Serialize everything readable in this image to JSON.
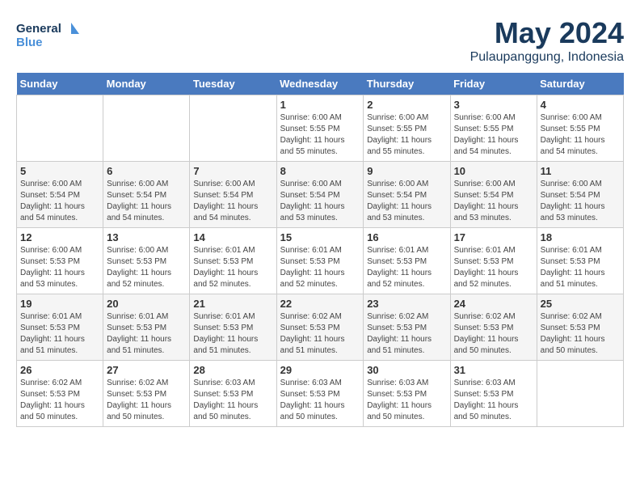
{
  "logo": {
    "line1": "General",
    "line2": "Blue"
  },
  "title": "May 2024",
  "location": "Pulaupanggung, Indonesia",
  "days_header": [
    "Sunday",
    "Monday",
    "Tuesday",
    "Wednesday",
    "Thursday",
    "Friday",
    "Saturday"
  ],
  "weeks": [
    [
      {
        "day": "",
        "info": ""
      },
      {
        "day": "",
        "info": ""
      },
      {
        "day": "",
        "info": ""
      },
      {
        "day": "1",
        "info": "Sunrise: 6:00 AM\nSunset: 5:55 PM\nDaylight: 11 hours\nand 55 minutes."
      },
      {
        "day": "2",
        "info": "Sunrise: 6:00 AM\nSunset: 5:55 PM\nDaylight: 11 hours\nand 55 minutes."
      },
      {
        "day": "3",
        "info": "Sunrise: 6:00 AM\nSunset: 5:55 PM\nDaylight: 11 hours\nand 54 minutes."
      },
      {
        "day": "4",
        "info": "Sunrise: 6:00 AM\nSunset: 5:55 PM\nDaylight: 11 hours\nand 54 minutes."
      }
    ],
    [
      {
        "day": "5",
        "info": "Sunrise: 6:00 AM\nSunset: 5:54 PM\nDaylight: 11 hours\nand 54 minutes."
      },
      {
        "day": "6",
        "info": "Sunrise: 6:00 AM\nSunset: 5:54 PM\nDaylight: 11 hours\nand 54 minutes."
      },
      {
        "day": "7",
        "info": "Sunrise: 6:00 AM\nSunset: 5:54 PM\nDaylight: 11 hours\nand 54 minutes."
      },
      {
        "day": "8",
        "info": "Sunrise: 6:00 AM\nSunset: 5:54 PM\nDaylight: 11 hours\nand 53 minutes."
      },
      {
        "day": "9",
        "info": "Sunrise: 6:00 AM\nSunset: 5:54 PM\nDaylight: 11 hours\nand 53 minutes."
      },
      {
        "day": "10",
        "info": "Sunrise: 6:00 AM\nSunset: 5:54 PM\nDaylight: 11 hours\nand 53 minutes."
      },
      {
        "day": "11",
        "info": "Sunrise: 6:00 AM\nSunset: 5:54 PM\nDaylight: 11 hours\nand 53 minutes."
      }
    ],
    [
      {
        "day": "12",
        "info": "Sunrise: 6:00 AM\nSunset: 5:53 PM\nDaylight: 11 hours\nand 53 minutes."
      },
      {
        "day": "13",
        "info": "Sunrise: 6:00 AM\nSunset: 5:53 PM\nDaylight: 11 hours\nand 52 minutes."
      },
      {
        "day": "14",
        "info": "Sunrise: 6:01 AM\nSunset: 5:53 PM\nDaylight: 11 hours\nand 52 minutes."
      },
      {
        "day": "15",
        "info": "Sunrise: 6:01 AM\nSunset: 5:53 PM\nDaylight: 11 hours\nand 52 minutes."
      },
      {
        "day": "16",
        "info": "Sunrise: 6:01 AM\nSunset: 5:53 PM\nDaylight: 11 hours\nand 52 minutes."
      },
      {
        "day": "17",
        "info": "Sunrise: 6:01 AM\nSunset: 5:53 PM\nDaylight: 11 hours\nand 52 minutes."
      },
      {
        "day": "18",
        "info": "Sunrise: 6:01 AM\nSunset: 5:53 PM\nDaylight: 11 hours\nand 51 minutes."
      }
    ],
    [
      {
        "day": "19",
        "info": "Sunrise: 6:01 AM\nSunset: 5:53 PM\nDaylight: 11 hours\nand 51 minutes."
      },
      {
        "day": "20",
        "info": "Sunrise: 6:01 AM\nSunset: 5:53 PM\nDaylight: 11 hours\nand 51 minutes."
      },
      {
        "day": "21",
        "info": "Sunrise: 6:01 AM\nSunset: 5:53 PM\nDaylight: 11 hours\nand 51 minutes."
      },
      {
        "day": "22",
        "info": "Sunrise: 6:02 AM\nSunset: 5:53 PM\nDaylight: 11 hours\nand 51 minutes."
      },
      {
        "day": "23",
        "info": "Sunrise: 6:02 AM\nSunset: 5:53 PM\nDaylight: 11 hours\nand 51 minutes."
      },
      {
        "day": "24",
        "info": "Sunrise: 6:02 AM\nSunset: 5:53 PM\nDaylight: 11 hours\nand 50 minutes."
      },
      {
        "day": "25",
        "info": "Sunrise: 6:02 AM\nSunset: 5:53 PM\nDaylight: 11 hours\nand 50 minutes."
      }
    ],
    [
      {
        "day": "26",
        "info": "Sunrise: 6:02 AM\nSunset: 5:53 PM\nDaylight: 11 hours\nand 50 minutes."
      },
      {
        "day": "27",
        "info": "Sunrise: 6:02 AM\nSunset: 5:53 PM\nDaylight: 11 hours\nand 50 minutes."
      },
      {
        "day": "28",
        "info": "Sunrise: 6:03 AM\nSunset: 5:53 PM\nDaylight: 11 hours\nand 50 minutes."
      },
      {
        "day": "29",
        "info": "Sunrise: 6:03 AM\nSunset: 5:53 PM\nDaylight: 11 hours\nand 50 minutes."
      },
      {
        "day": "30",
        "info": "Sunrise: 6:03 AM\nSunset: 5:53 PM\nDaylight: 11 hours\nand 50 minutes."
      },
      {
        "day": "31",
        "info": "Sunrise: 6:03 AM\nSunset: 5:53 PM\nDaylight: 11 hours\nand 50 minutes."
      },
      {
        "day": "",
        "info": ""
      }
    ]
  ]
}
